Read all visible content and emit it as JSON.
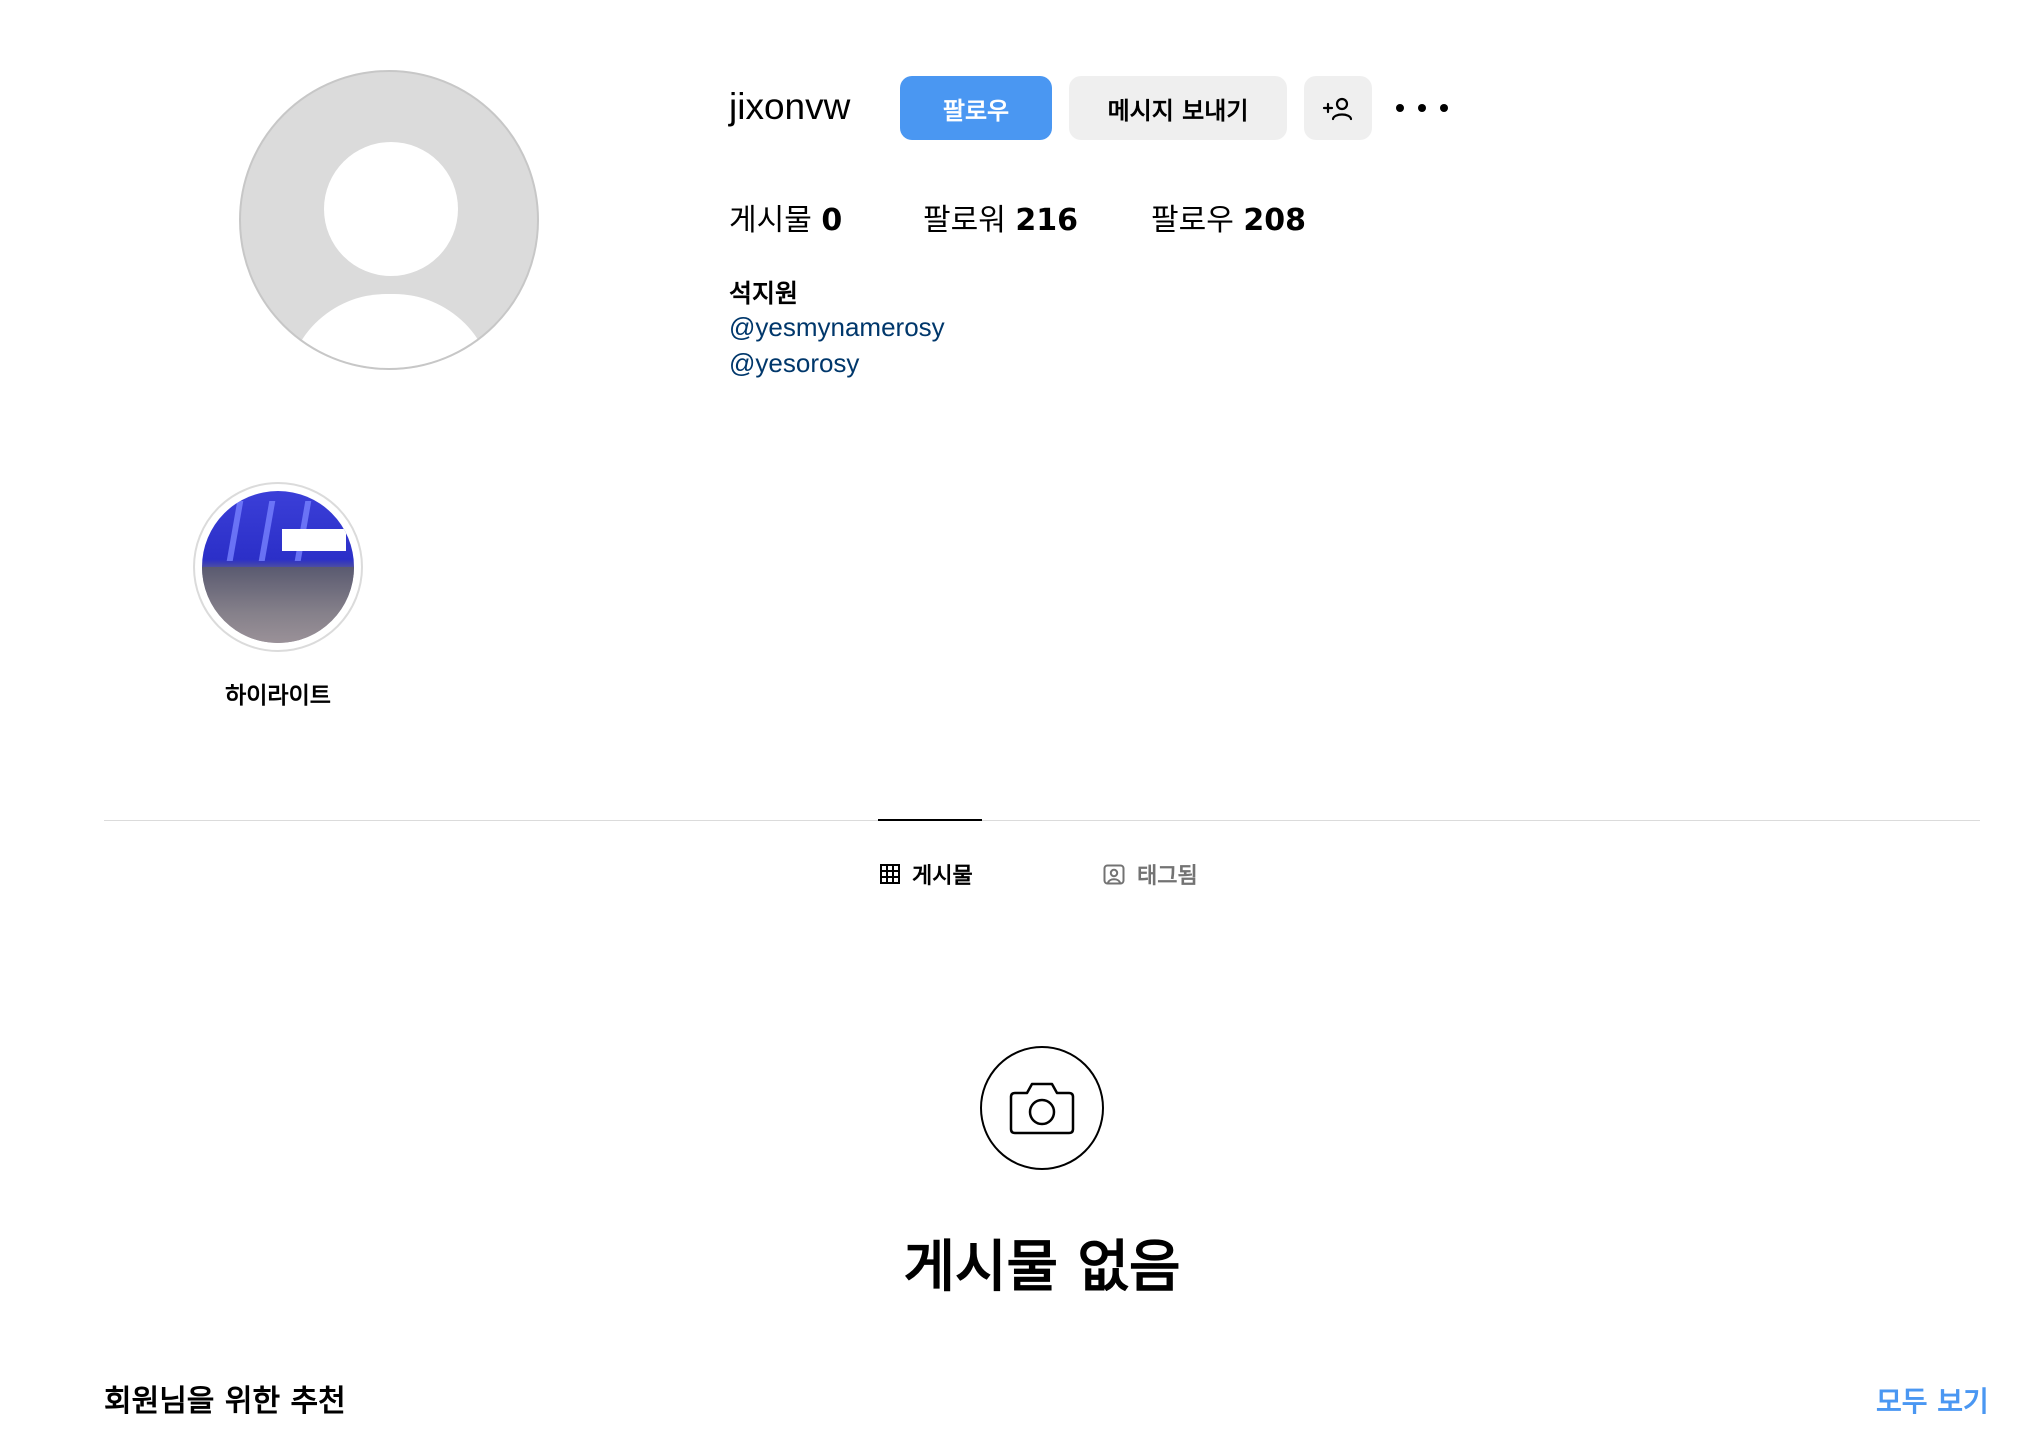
{
  "profile": {
    "username": "jixonvw",
    "follow_label": "팔로우",
    "message_label": "메시지 보내기",
    "add_user_icon": "add-user-icon",
    "more_icon": "more-dots-icon"
  },
  "stats": {
    "posts_label": "게시물",
    "posts_count": "0",
    "followers_label": "팔로워",
    "followers_count": "216",
    "following_label": "팔로우",
    "following_count": "208"
  },
  "bio": {
    "name": "석지원",
    "links": [
      "@yesmynamerosy",
      "@yesorosy"
    ]
  },
  "highlights": [
    {
      "label": "하이라이트"
    }
  ],
  "tabs": [
    {
      "label": "게시물",
      "icon": "grid-icon",
      "active": true
    },
    {
      "label": "태그됨",
      "icon": "tagged-icon",
      "active": false
    }
  ],
  "empty_state": {
    "icon": "camera-icon",
    "title": "게시물 없음"
  },
  "suggestions": {
    "title": "회원님을 위한 추천",
    "see_all": "모두 보기"
  },
  "colors": {
    "primary_button": "#4a97f2",
    "secondary_button": "#efefef",
    "link": "#00376b",
    "muted": "#737373"
  }
}
